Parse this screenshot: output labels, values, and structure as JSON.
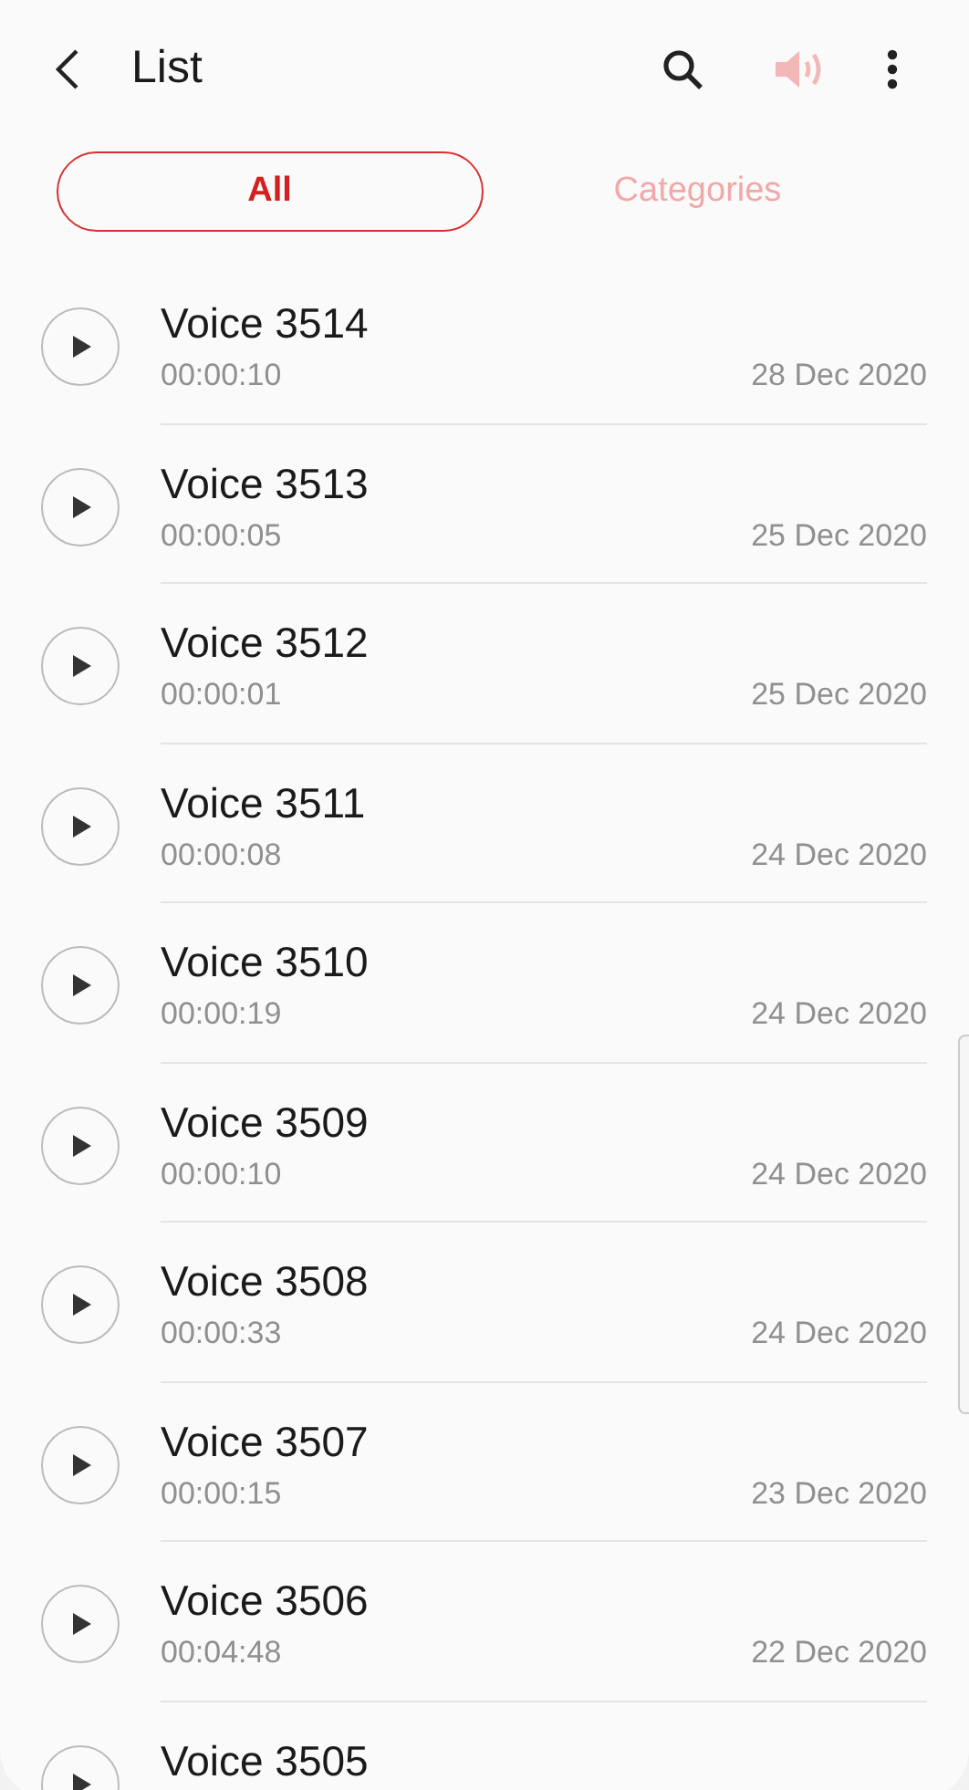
{
  "header": {
    "title": "List"
  },
  "tabs": [
    {
      "label": "All",
      "selected": true
    },
    {
      "label": "Categories",
      "selected": false
    }
  ],
  "recordings": [
    {
      "name": "Voice 3514",
      "duration": "00:00:10",
      "date": "28 Dec 2020"
    },
    {
      "name": "Voice 3513",
      "duration": "00:00:05",
      "date": "25 Dec 2020"
    },
    {
      "name": "Voice 3512",
      "duration": "00:00:01",
      "date": "25 Dec 2020"
    },
    {
      "name": "Voice 3511",
      "duration": "00:00:08",
      "date": "24 Dec 2020"
    },
    {
      "name": "Voice 3510",
      "duration": "00:00:19",
      "date": "24 Dec 2020"
    },
    {
      "name": "Voice 3509",
      "duration": "00:00:10",
      "date": "24 Dec 2020"
    },
    {
      "name": "Voice 3508",
      "duration": "00:00:33",
      "date": "24 Dec 2020"
    },
    {
      "name": "Voice 3507",
      "duration": "00:00:15",
      "date": "23 Dec 2020"
    },
    {
      "name": "Voice 3506",
      "duration": "00:04:48",
      "date": "22 Dec 2020"
    },
    {
      "name": "Voice 3505"
    }
  ]
}
